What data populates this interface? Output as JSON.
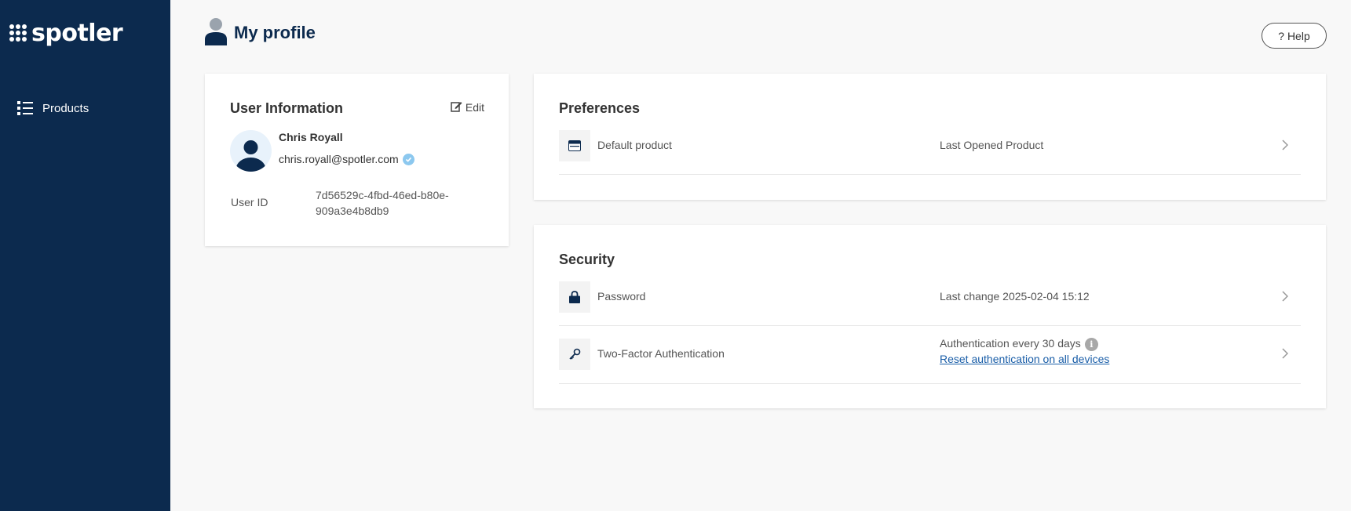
{
  "brand": {
    "name": "spotler",
    "icon": "grid-dots-icon"
  },
  "sidebar": {
    "items": [
      {
        "label": "Products",
        "icon": "list-icon"
      }
    ]
  },
  "header": {
    "title": "My profile",
    "icon": "person-icon",
    "help_label": "? Help"
  },
  "user_info": {
    "title": "User Information",
    "edit_label": "Edit",
    "name": "Chris Royall",
    "email": "chris.royall@spotler.com",
    "user_id_label": "User ID",
    "user_id": "7d56529c-4fbd-46ed-b80e-909a3e4b8db9"
  },
  "preferences": {
    "title": "Preferences",
    "rows": [
      {
        "label": "Default product",
        "value": "Last Opened Product",
        "icon": "browser-window-icon"
      }
    ]
  },
  "security": {
    "title": "Security",
    "password": {
      "label": "Password",
      "value": "Last change 2025-02-04 15:12",
      "icon": "lock-icon"
    },
    "two_factor": {
      "label": "Two-Factor Authentication",
      "value": "Authentication every 30 days",
      "link": "Reset authentication on all devices",
      "icon": "key-icon"
    }
  },
  "colors": {
    "sidebar": "#0c2a4e",
    "accent": "#1a5ea8",
    "background": "#f8f8f8"
  }
}
